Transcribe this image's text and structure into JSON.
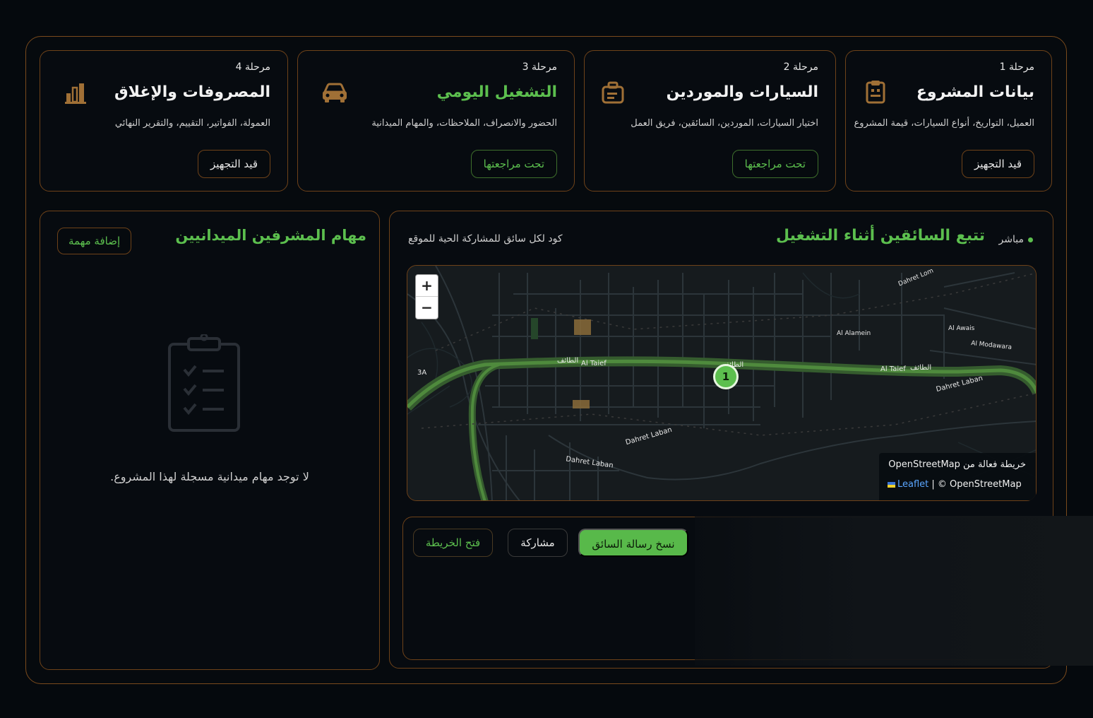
{
  "stages": [
    {
      "stage": "مرحلة 1",
      "title": "بيانات المشروع",
      "desc": "العميل، التواريخ، أنواع السيارات، قيمة المشروع",
      "button": "قيد التجهيز",
      "icon": "clipboard-icon"
    },
    {
      "stage": "مرحلة 2",
      "title": "السيارات والموردين",
      "desc": "اختيار السيارات، الموردين، السائقين، فريق العمل",
      "button": "تحت مراجعتها",
      "icon": "briefcase-icon"
    },
    {
      "stage": "مرحلة 3",
      "title": "التشغيل اليومي",
      "desc": "الحضور والانصراف، الملاحظات، والمهام الميدانية",
      "button": "تحت مراجعتها",
      "icon": "car-icon"
    },
    {
      "stage": "مرحلة 4",
      "title": "المصروفات والإغلاق",
      "desc": "العمولة، الفواتير، التقييم، والتقرير النهائي",
      "button": "قيد التجهيز",
      "icon": "bar-chart-icon"
    }
  ],
  "tasks_panel": {
    "title": "مهام المشرفين الميدانيين",
    "add_button": "إضافة مهمة",
    "empty_text": "لا توجد مهام ميدانية مسجلة لهذا المشروع."
  },
  "tracking_panel": {
    "live_label": "مباشر",
    "title": "تتبع السائقين أثناء التشغيل",
    "subtitle": "كود لكل سائق للمشاركة الحية للموقع"
  },
  "map": {
    "zoom_in": "+",
    "zoom_out": "−",
    "marker_label": "1",
    "attribution_line1": "خريطة فعالة من OpenStreetMap",
    "attribution_leaflet": "Leaflet",
    "attribution_osm": "| © OpenStreetMap",
    "labels": {
      "al_taief_1": "Al Taief",
      "taif_ar_1": "الطائف",
      "taif_ar_2": "الطائف",
      "al_taief_2": "Al Taief",
      "taif_ar_3": "الطائف",
      "dahret_laban_1": "Dahret Laban",
      "dahret_laban_2": "Dahret Laban",
      "dahret_laban_3": "Dahret Laban",
      "al_alamein": "Al Alamein",
      "al_awais": "Al Awais",
      "al_modawara": "Al Modawara",
      "three_a": "3A",
      "dahret_lom": "Dahret Lom"
    }
  },
  "actions": {
    "copy_message": "نسخ رسالة السائق",
    "share": "مشاركة",
    "open_map": "فتح الخريطة"
  },
  "colors": {
    "accent_green": "#5cbf4e",
    "border_brown": "#6e4219",
    "background": "#05090d"
  }
}
